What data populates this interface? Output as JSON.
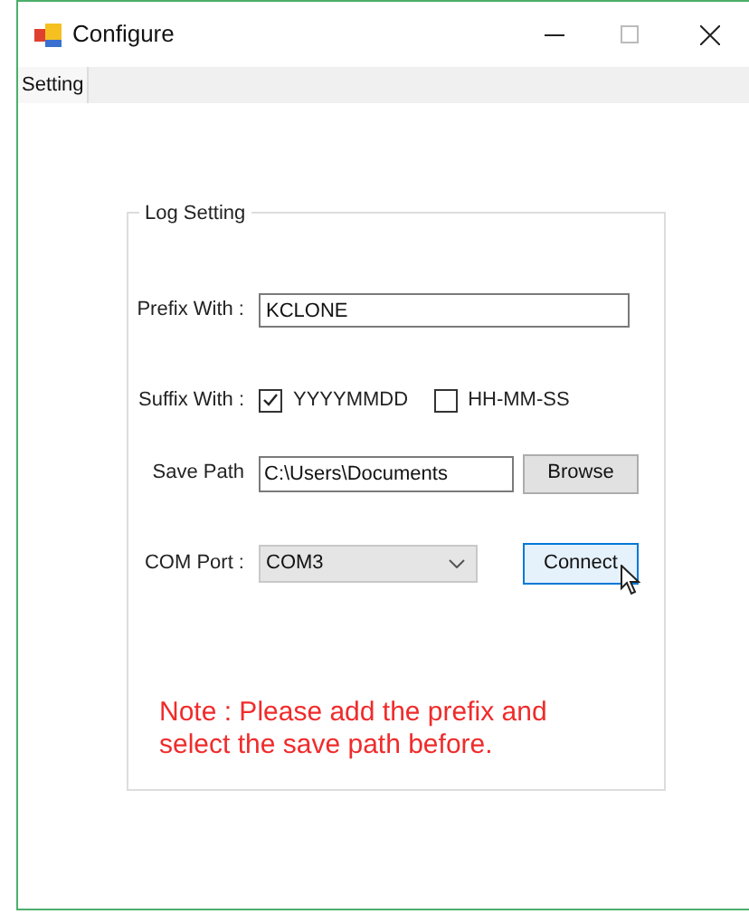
{
  "window": {
    "title": "Configure"
  },
  "tabs": [
    {
      "label": "Setting",
      "selected": true
    }
  ],
  "log_setting": {
    "title": "Log Setting",
    "prefix": {
      "label": "Prefix With :",
      "value": "KCLONE"
    },
    "suffix": {
      "label": "Suffix With :",
      "options": [
        {
          "label": "YYYYMMDD",
          "checked": true
        },
        {
          "label": "HH-MM-SS",
          "checked": false
        }
      ]
    },
    "save_path": {
      "label": "Save Path",
      "value": "C:\\Users\\Documents",
      "button": "Browse"
    },
    "com_port": {
      "label": "COM Port :",
      "value": "COM3",
      "button": "Connect"
    },
    "note": "Note : Please add the prefix and select the save path before."
  }
}
